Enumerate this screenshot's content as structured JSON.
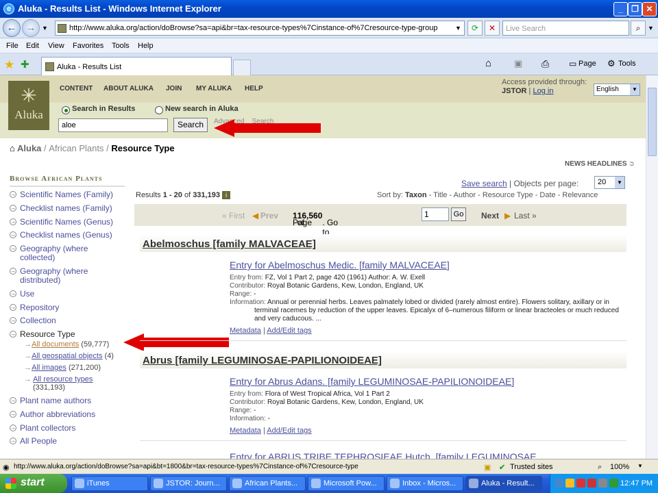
{
  "window": {
    "title": "Aluka - Results List - Windows Internet Explorer"
  },
  "browser": {
    "url": "http://www.aluka.org/action/doBrowse?sa=api&br=tax-resource-types%7Cinstance-of%7Cresource-type-group",
    "search_placeholder": "Live Search",
    "menu": [
      "File",
      "Edit",
      "View",
      "Favorites",
      "Tools",
      "Help"
    ],
    "tab_title": "Aluka - Results List",
    "page_menu": "Page",
    "tools_menu": "Tools"
  },
  "site": {
    "logo_text": "Aluka",
    "nav": [
      "CONTENT",
      "ABOUT ALUKA",
      "JOIN",
      "MY ALUKA",
      "HELP"
    ],
    "access_label": "Access provided through:",
    "access_org": "JSTOR",
    "login": "Log in",
    "language": "English",
    "radio_results": "Search in Results",
    "radio_new": "New search in Aluka",
    "search_value": "aloe",
    "search_button": "Search",
    "advanced1": "Advanced",
    "advanced2": "Search"
  },
  "breadcrumb": {
    "home": "Aluka",
    "sep1": "/",
    "mid": "African Plants",
    "sep2": "/",
    "current": "Resource Type"
  },
  "sidebar": {
    "title": "Browse African Plants",
    "items": [
      "Scientific Names (Family)",
      "Checklist names (Family)",
      "Scientific Names (Genus)",
      "Checklist names (Genus)",
      "Geography (where collected)",
      "Geography (where distributed)",
      "Use",
      "Repository",
      "Collection",
      "Resource Type",
      "Plant name authors",
      "Author abbreviations",
      "Plant collectors",
      "All People"
    ],
    "subitems": [
      {
        "label": "All documents",
        "count": "(59,777)"
      },
      {
        "label": "All geospatial objects",
        "count": "(4)"
      },
      {
        "label": "All images",
        "count": "(271,200)"
      },
      {
        "label": "All resource types",
        "count": "(331,193)"
      }
    ]
  },
  "results": {
    "news": "NEWS HEADLINES",
    "save_search": "Save search",
    "objects_per_page_label": "| Objects per page:",
    "per_page": "20",
    "summary_prefix": "Results ",
    "summary_range": "1 - 20",
    "summary_of": " of ",
    "summary_total": "331,193",
    "sort_label": "Sort by:",
    "sort_active": "Taxon",
    "sort_options": "- Title - Author - Resource Type - Date - Relevance",
    "first": "« First",
    "prev": "Prev",
    "page_text_a": "Page ",
    "page_current": "1",
    "page_text_b": " of ",
    "page_total": "16,560",
    "page_text_c": ". Go to page:",
    "goto_value": "1",
    "go_button": "Go",
    "next": "Next",
    "last": "Last »",
    "groups": [
      {
        "heading": "Abelmoschus [family MALVACEAE]",
        "entry_title": "Entry for Abelmoschus Medic. [family MALVACEAE]",
        "entry_from": "FZ, Vol 1 Part 2, page 420 (1961) Author: A. W. Exell",
        "contributor": "Royal Botanic Gardens, Kew, London, England, UK",
        "range": "-",
        "information": "Annual or perennial herbs. Leaves palmately lobed or divided (rarely almost entire). Flowers solitary, axillary or in terminal racemes by reduction of the upper leaves. Epicalyx of 6–numerous filiform or linear bracteoles or much reduced and very caducous. ..."
      },
      {
        "heading": "Abrus [family LEGUMINOSAE-PAPILIONOIDEAE]",
        "entry_title": "Entry for Abrus Adans. [family LEGUMINOSAE-PAPILIONOIDEAE]",
        "entry_from": "Flora of West Tropical Africa, Vol 1 Part 2",
        "contributor": "Royal Botanic Gardens, Kew, London, England, UK",
        "range": "-",
        "information": "-"
      }
    ],
    "labels": {
      "entry_from": "Entry from:",
      "contributor": "Contributor:",
      "range": "Range:",
      "information": "Information:"
    },
    "metadata": "Metadata",
    "edit_tags": "Add/Edit tags",
    "next_partial": "Entry for ABRUS TRIBE TEPHROSIEAE Hutch. [family LEGUMINOSAE"
  },
  "status": {
    "url": "http://www.aluka.org/action/doBrowse?sa=api&bt=1800&br=tax-resource-types%7Cinstance-of%7Cresource-type",
    "zone": "Trusted sites",
    "zoom": "100%"
  },
  "taskbar": {
    "start": "start",
    "tasks": [
      "iTunes",
      "JSTOR: Journ...",
      "African Plants...",
      "Microsoft Pow...",
      "Inbox - Micros...",
      "Aluka - Result..."
    ],
    "clock": "12:47 PM"
  },
  "colors": {
    "annotation_arrow": "#e00000",
    "site_header": "#e4e6c9",
    "link": "#4a4f9a"
  }
}
